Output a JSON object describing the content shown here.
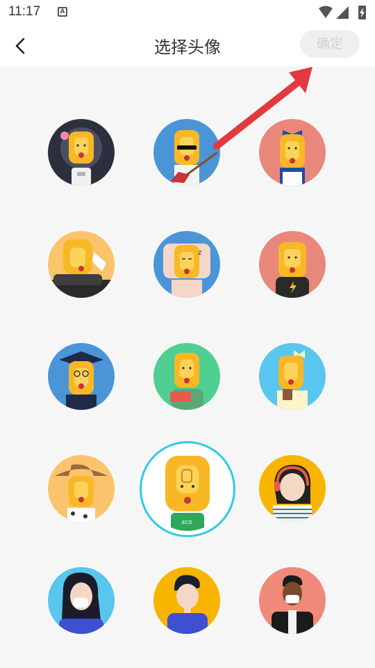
{
  "status_bar": {
    "time": "11:17",
    "notification_icon": "a-icon",
    "icons": [
      "wifi-icon",
      "signal-icon",
      "battery-charging-icon"
    ]
  },
  "nav": {
    "back_icon": "chevron-left-icon",
    "title": "选择头像",
    "confirm_label": "确定"
  },
  "annotation": {
    "arrow_color": "#e23a3f"
  },
  "avatars": [
    {
      "id": "astronaut-lion",
      "bg": "#2c2f3d"
    },
    {
      "id": "rockstar-lion",
      "bg": "#4a95d8"
    },
    {
      "id": "bow-girl-lion",
      "bg": "#e8887a"
    },
    {
      "id": "relaxing-lion",
      "bg": "#fbc36b"
    },
    {
      "id": "sleeping-lion",
      "bg": "#4a95d8"
    },
    {
      "id": "lightning-tee-lion",
      "bg": "#e8887a"
    },
    {
      "id": "graduate-lion",
      "bg": "#4a95d8"
    },
    {
      "id": "reader-lion",
      "bg": "#4fcf92"
    },
    {
      "id": "coffee-bow-lion",
      "bg": "#58c6ee"
    },
    {
      "id": "cowboy-lion",
      "bg": "#fbc36b"
    },
    {
      "id": "default-lion",
      "bg": "#ffffff",
      "selected": true
    },
    {
      "id": "headphones-girl",
      "bg": "#f7b500"
    },
    {
      "id": "masked-woman",
      "bg": "#58c6ee"
    },
    {
      "id": "young-man",
      "bg": "#f7b500"
    },
    {
      "id": "masked-man",
      "bg": "#ef8a7a"
    }
  ],
  "colors": {
    "selected_ring": "#2ecbe6",
    "lion_yellow": "#f8b826",
    "lion_face": "#fbd35a"
  }
}
